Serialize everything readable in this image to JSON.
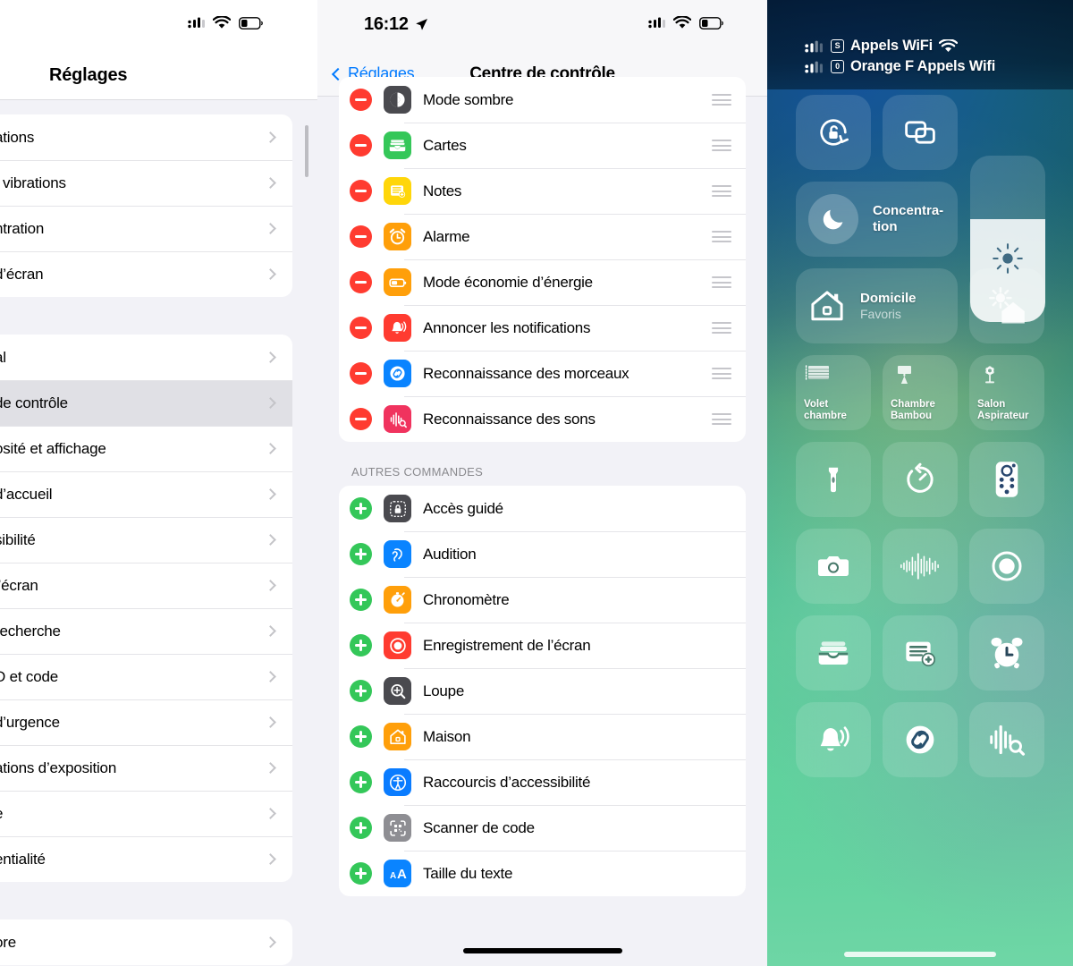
{
  "left_panel": {
    "status_bar": {
      "cellular_icon": "cellular-bars-icon",
      "wifi_icon": "wifi-icon",
      "battery_icon": "battery-low-icon"
    },
    "title": "Réglages",
    "groups": [
      {
        "items": [
          {
            "label": "ations"
          },
          {
            "label": "t vibrations"
          },
          {
            "label": "ntration"
          },
          {
            "label": "d’écran"
          }
        ]
      },
      {
        "items": [
          {
            "label": "al",
            "selected": false
          },
          {
            "label": " de contrôle",
            "selected": true
          },
          {
            "label": "osité et affichage",
            "selected": false
          },
          {
            "label": "d’accueil",
            "selected": false
          },
          {
            "label": "sibilité",
            "selected": false
          },
          {
            "label": "l’écran",
            "selected": false
          },
          {
            "label": "recherche",
            "selected": false
          },
          {
            "label": "D et code",
            "selected": false
          },
          {
            "label": "d’urgence",
            "selected": false
          },
          {
            "label": "ations d’exposition",
            "selected": false
          },
          {
            "label": "e",
            "selected": false
          },
          {
            "label": "entialité",
            "selected": false
          }
        ]
      },
      {
        "items": [
          {
            "label": "ore"
          }
        ]
      }
    ]
  },
  "mid_panel": {
    "status_bar": {
      "time": "16:12",
      "location_icon": "location-arrow-icon",
      "cellular_icon": "cellular-bars-icon",
      "wifi_icon": "wifi-icon",
      "battery_icon": "battery-low-icon"
    },
    "nav": {
      "back_label": "Réglages",
      "title": "Centre de contrôle"
    },
    "included_section": {
      "items": [
        {
          "label": "Mode sombre",
          "icon": "dark-mode-icon",
          "icon_bg": "#4a4a4f",
          "action": "remove"
        },
        {
          "label": "Cartes",
          "icon": "wallet-icon",
          "icon_bg": "#35c759",
          "action": "remove"
        },
        {
          "label": "Notes",
          "icon": "notes-add-icon",
          "icon_bg": "#ffd60a",
          "action": "remove"
        },
        {
          "label": "Alarme",
          "icon": "alarm-clock-icon",
          "icon_bg": "#ff9f0a",
          "action": "remove"
        },
        {
          "label": "Mode économie d’énergie",
          "icon": "battery-saver-icon",
          "icon_bg": "#ff9f0a",
          "action": "remove"
        },
        {
          "label": "Annoncer les notifications",
          "icon": "announce-bell-icon",
          "icon_bg": "#ff3b30",
          "action": "remove"
        },
        {
          "label": "Reconnaissance des morceaux",
          "icon": "shazam-icon",
          "icon_bg": "#0a84ff",
          "action": "remove"
        },
        {
          "label": "Reconnaissance des sons",
          "icon": "sound-recognition-icon",
          "icon_bg": "#f0335e",
          "action": "remove"
        }
      ]
    },
    "other_section": {
      "header": "AUTRES COMMANDES",
      "items": [
        {
          "label": "Accès guidé",
          "icon": "guided-access-lock-icon",
          "icon_bg": "#4a4a4f",
          "action": "add"
        },
        {
          "label": "Audition",
          "icon": "hearing-ear-icon",
          "icon_bg": "#0a84ff",
          "action": "add"
        },
        {
          "label": "Chronomètre",
          "icon": "stopwatch-icon",
          "icon_bg": "#ff9f0a",
          "action": "add"
        },
        {
          "label": "Enregistrement de l’écran",
          "icon": "screen-record-icon",
          "icon_bg": "#ff3b30",
          "action": "add"
        },
        {
          "label": "Loupe",
          "icon": "magnifier-icon",
          "icon_bg": "#4a4a4f",
          "action": "add"
        },
        {
          "label": "Maison",
          "icon": "home-house-icon",
          "icon_bg": "#ff9f0a",
          "action": "add"
        },
        {
          "label": "Raccourcis d’accessibilité",
          "icon": "accessibility-icon",
          "icon_bg": "#0a7cff",
          "action": "add"
        },
        {
          "label": "Scanner de code",
          "icon": "qr-scanner-icon",
          "icon_bg": "#8e8e93",
          "action": "add"
        },
        {
          "label": "Taille du texte",
          "icon": "text-size-icon",
          "icon_bg": "#0a84ff",
          "action": "add"
        }
      ]
    },
    "home_indicator": "home-bar-icon"
  },
  "control_center": {
    "carrier_lines": [
      {
        "sim": "S",
        "label": "Appels WiFi",
        "wifi_icon": "wifi-icon"
      },
      {
        "sim": "0",
        "label": "Orange F Appels Wifi",
        "wifi_icon": ""
      }
    ],
    "tiles": {
      "rotation_lock": {
        "name": "Verrouillage de l’orientation",
        "icon": "rotation-lock-icon"
      },
      "screen_mirroring": {
        "name": "Recopie de l’écran",
        "icon": "screen-mirroring-icon"
      },
      "focus": {
        "label": "Concentra-\ntion",
        "icon": "moon-icon"
      },
      "brightness": {
        "name": "Luminosité",
        "icon": "brightness-sun-icon",
        "fill_percent": 62
      },
      "home": {
        "title": "Domicile",
        "subtitle": "Favoris",
        "icon": "home-house-icon"
      },
      "home_scene": {
        "name": "Scène maison",
        "icon": "sun-house-icon"
      },
      "accessories": [
        {
          "label": "Volet\nchambre",
          "icon": "blinds-icon"
        },
        {
          "label": "Chambre\nBambou",
          "icon": "lamp-icon"
        },
        {
          "label": "Salon\nAspirateur",
          "icon": "fan-icon"
        }
      ],
      "utilities_row1": [
        {
          "name": "Lampe torche",
          "icon": "flashlight-icon"
        },
        {
          "name": "Minuteur",
          "icon": "timer-icon"
        },
        {
          "name": "Télécommande Apple TV",
          "icon": "remote-icon"
        }
      ],
      "utilities_row2": [
        {
          "name": "Appareil photo",
          "icon": "camera-icon"
        },
        {
          "name": "Mémo vocal",
          "icon": "waveform-icon"
        },
        {
          "name": "Enregistrement de l’écran",
          "icon": "screen-record-icon"
        }
      ],
      "utilities_row3": [
        {
          "name": "Cartes",
          "icon": "wallet-icon"
        },
        {
          "name": "Notes",
          "icon": "notes-add-icon"
        },
        {
          "name": "Alarme",
          "icon": "alarm-clock-icon"
        }
      ],
      "utilities_row4": [
        {
          "name": "Annoncer les notifications",
          "icon": "announce-bell-icon"
        },
        {
          "name": "Reconnaissance des morceaux",
          "icon": "shazam-icon"
        },
        {
          "name": "Reconnaissance des sons",
          "icon": "sound-recognition-icon"
        }
      ]
    },
    "home_indicator": "home-bar-icon"
  },
  "colors": {
    "ios_blue": "#007aff",
    "remove_red": "#ff3b30",
    "add_green": "#34c759",
    "group_bg": "#f2f2f7"
  }
}
